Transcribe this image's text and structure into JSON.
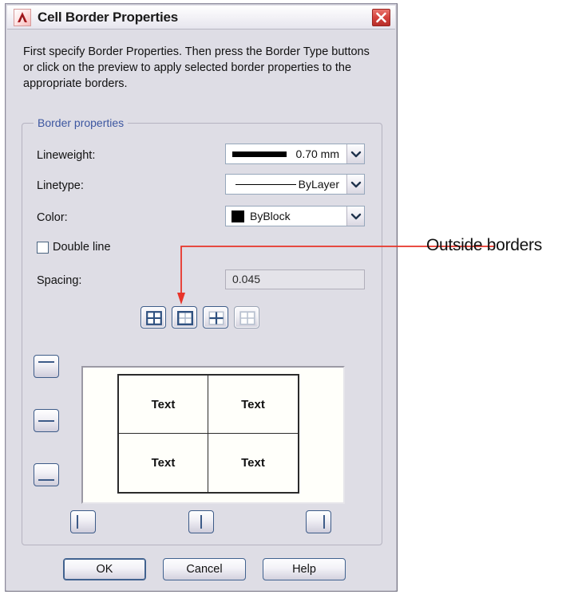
{
  "window": {
    "title": "Cell Border Properties",
    "logo_icon": "autocad-a-icon",
    "close_icon": "close-icon"
  },
  "intro": {
    "text": "First specify Border Properties. Then press the Border Type buttons or click on the preview to apply selected border properties to the appropriate borders."
  },
  "border_properties": {
    "group_title": "Border properties",
    "lineweight": {
      "label": "Lineweight:",
      "value": "0.70 mm",
      "swatch_icon": "thick-line-swatch",
      "dropdown_icon": "chevron-down-icon"
    },
    "linetype": {
      "label": "Linetype:",
      "value": "ByLayer",
      "swatch_icon": "thin-line-swatch",
      "dropdown_icon": "chevron-down-icon"
    },
    "color": {
      "label": "Color:",
      "value": "ByBlock",
      "swatch_color": "#000000",
      "swatch_icon": "color-swatch",
      "dropdown_icon": "chevron-down-icon"
    },
    "double_line": {
      "label": "Double line",
      "checked": false,
      "checkbox_icon": "checkbox-unchecked-icon"
    },
    "spacing": {
      "label": "Spacing:",
      "value": "0.045",
      "placeholder": "0.045",
      "enabled": false
    }
  },
  "border_type_buttons": [
    {
      "name": "all-borders-button",
      "icon": "grid-all-borders-icon",
      "state": "enabled"
    },
    {
      "name": "outside-borders-button",
      "icon": "grid-outside-borders-icon",
      "state": "enabled"
    },
    {
      "name": "inside-borders-button",
      "icon": "grid-inside-borders-icon",
      "state": "enabled"
    },
    {
      "name": "no-borders-button",
      "icon": "grid-no-borders-icon",
      "state": "dimmed"
    }
  ],
  "preview": {
    "cells": [
      [
        "Text",
        "Text"
      ],
      [
        "Text",
        "Text"
      ]
    ],
    "left_edge_buttons": [
      {
        "name": "top-horizontal-border-button",
        "icon": "horizontal-line-top-icon"
      },
      {
        "name": "middle-horizontal-border-button",
        "icon": "horizontal-line-middle-icon"
      },
      {
        "name": "bottom-horizontal-border-button",
        "icon": "horizontal-line-bottom-icon"
      }
    ],
    "bottom_edge_buttons": [
      {
        "name": "left-vertical-border-button",
        "icon": "vertical-line-left-icon"
      },
      {
        "name": "center-vertical-border-button",
        "icon": "vertical-line-center-icon"
      },
      {
        "name": "right-vertical-border-button",
        "icon": "vertical-line-right-icon"
      }
    ]
  },
  "footer": {
    "ok": "OK",
    "cancel": "Cancel",
    "help": "Help"
  },
  "annotation": {
    "label": "Outside borders",
    "leader_color": "#e8342a"
  }
}
